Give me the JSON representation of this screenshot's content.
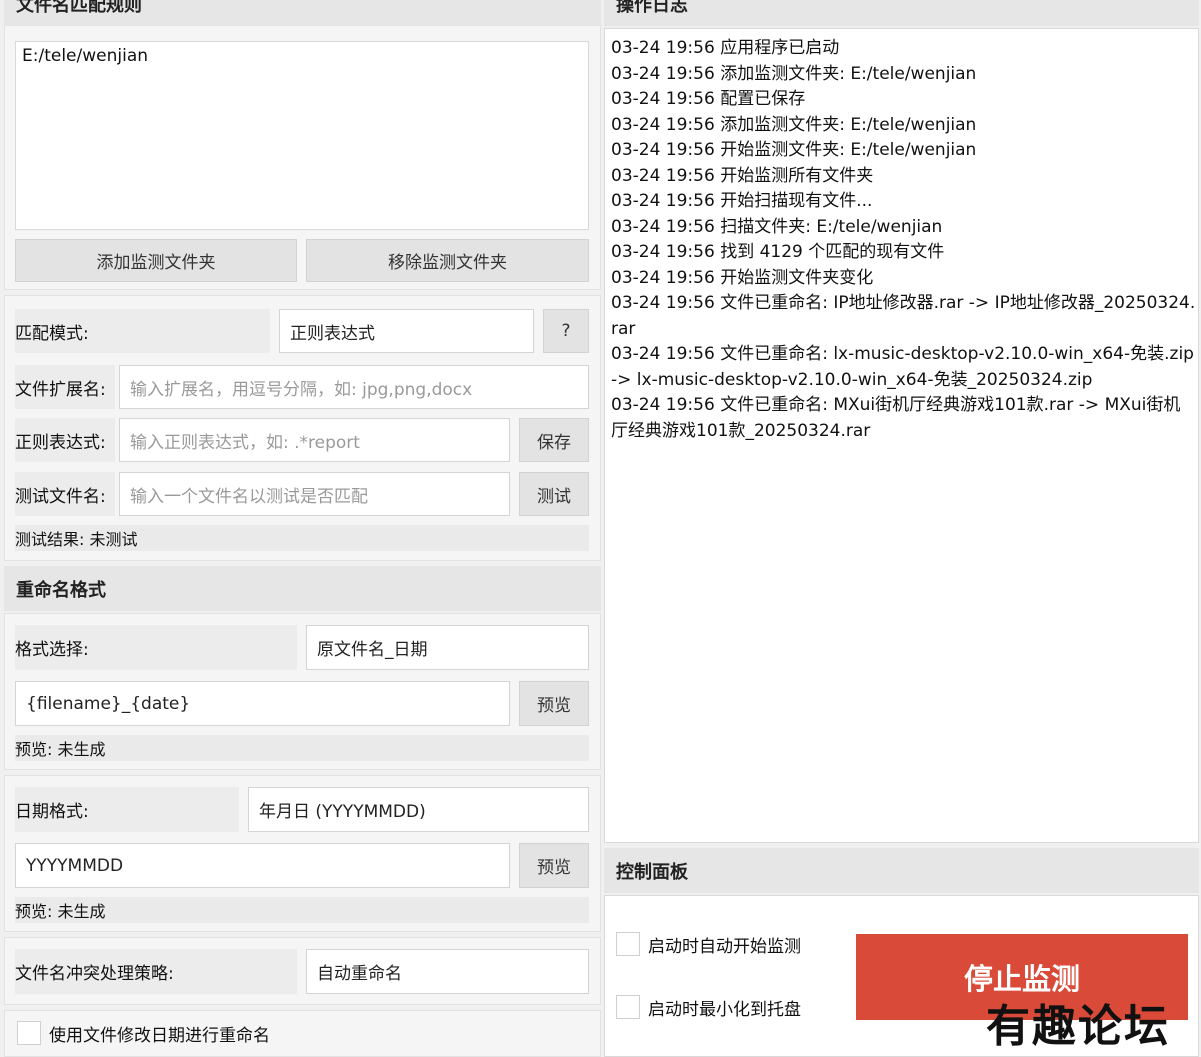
{
  "match_rules": {
    "title": "文件名匹配规则",
    "folder_list": [
      "E:/tele/wenjian"
    ],
    "add_folder_button": "添加监测文件夹",
    "remove_folder_button": "移除监测文件夹",
    "mode_label": "匹配模式:",
    "mode_value": "正则表达式",
    "help_button": "?",
    "ext_label": "文件扩展名:",
    "ext_placeholder": "输入扩展名，用逗号分隔，如: jpg,png,docx",
    "regex_label": "正则表达式:",
    "regex_placeholder": "输入正则表达式，如: .*report",
    "save_button": "保存",
    "test_label": "测试文件名:",
    "test_placeholder": "输入一个文件名以测试是否匹配",
    "test_button": "测试",
    "test_result": "测试结果: 未测试"
  },
  "rename_format": {
    "title": "重命名格式",
    "format_label": "格式选择:",
    "format_value": "原文件名_日期",
    "template_value": "{filename}_{date}",
    "preview_button": "预览",
    "preview_result": "预览: 未生成"
  },
  "date_format": {
    "label": "日期格式:",
    "value": "年月日 (YYYYMMDD)",
    "pattern_value": "YYYYMMDD",
    "preview_button": "预览",
    "preview_result": "预览: 未生成"
  },
  "conflict": {
    "label": "文件名冲突处理策略:",
    "value": "自动重命名"
  },
  "use_modified_date": {
    "label": "使用文件修改日期进行重命名"
  },
  "log": {
    "title": "操作日志",
    "entries": [
      "03-24 19:56 应用程序已启动",
      "03-24 19:56 添加监测文件夹: E:/tele/wenjian",
      "03-24 19:56 配置已保存",
      "03-24 19:56 添加监测文件夹: E:/tele/wenjian",
      "03-24 19:56 开始监测文件夹: E:/tele/wenjian",
      "03-24 19:56 开始监测所有文件夹",
      "03-24 19:56 开始扫描现有文件...",
      "03-24 19:56 扫描文件夹: E:/tele/wenjian",
      "03-24 19:56 找到 4129 个匹配的现有文件",
      "03-24 19:56 开始监测文件夹变化",
      "03-24 19:56 文件已重命名: IP地址修改器.rar -> IP地址修改器_20250324.rar",
      "03-24 19:56 文件已重命名: lx-music-desktop-v2.10.0-win_x64-免装.zip -> lx-music-desktop-v2.10.0-win_x64-免装_20250324.zip",
      "03-24 19:56 文件已重命名: MXui街机厅经典游戏101款.rar -> MXui街机厅经典游戏101款_20250324.rar"
    ]
  },
  "control": {
    "title": "控制面板",
    "auto_start_label": "启动时自动开始监测",
    "minimize_label": "启动时最小化到托盘",
    "stop_button": "停止监测",
    "stop_color": "#d94a38"
  },
  "watermark": "有趣论坛"
}
